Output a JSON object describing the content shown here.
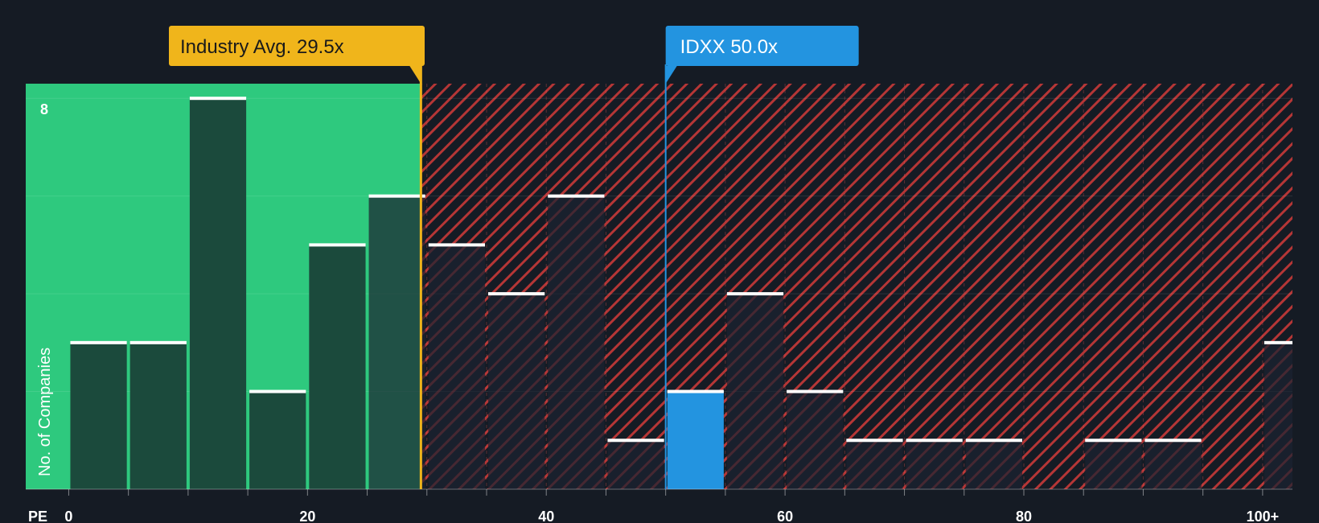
{
  "chart_data": {
    "type": "bar",
    "xlabel": "PE",
    "ylabel": "No. of Companies",
    "x_ticks": [
      "0",
      "20",
      "40",
      "60",
      "80",
      "100+"
    ],
    "y_ticks": [
      "8"
    ],
    "bin_width": 5,
    "bins_start": [
      0,
      5,
      10,
      15,
      20,
      25,
      30,
      35,
      40,
      45,
      50,
      55,
      60,
      65,
      70,
      75,
      80,
      85,
      90,
      95,
      100
    ],
    "values": [
      3,
      3,
      8,
      2,
      5,
      6,
      5,
      4,
      6,
      1,
      2,
      4,
      2,
      1,
      1,
      1,
      0,
      1,
      1,
      0,
      3
    ],
    "ylim": [
      0,
      8.3
    ],
    "xlim": [
      -3.6,
      102.5
    ],
    "industry_avg": {
      "label": "Industry Avg. 29.5x",
      "value": 29.5
    },
    "company": {
      "label": "IDXX 50.0x",
      "value": 50.0
    },
    "colors": {
      "fair_zone": "#2ec97e",
      "overvalued_zone": "#c23b3b",
      "bar_in_fair": "#1b4a3c",
      "bar_in_over": "#1c2230",
      "bar_top": "#ffffff",
      "industry": "#f0b51b",
      "company": "#2394e0",
      "background": "#151b24"
    }
  }
}
